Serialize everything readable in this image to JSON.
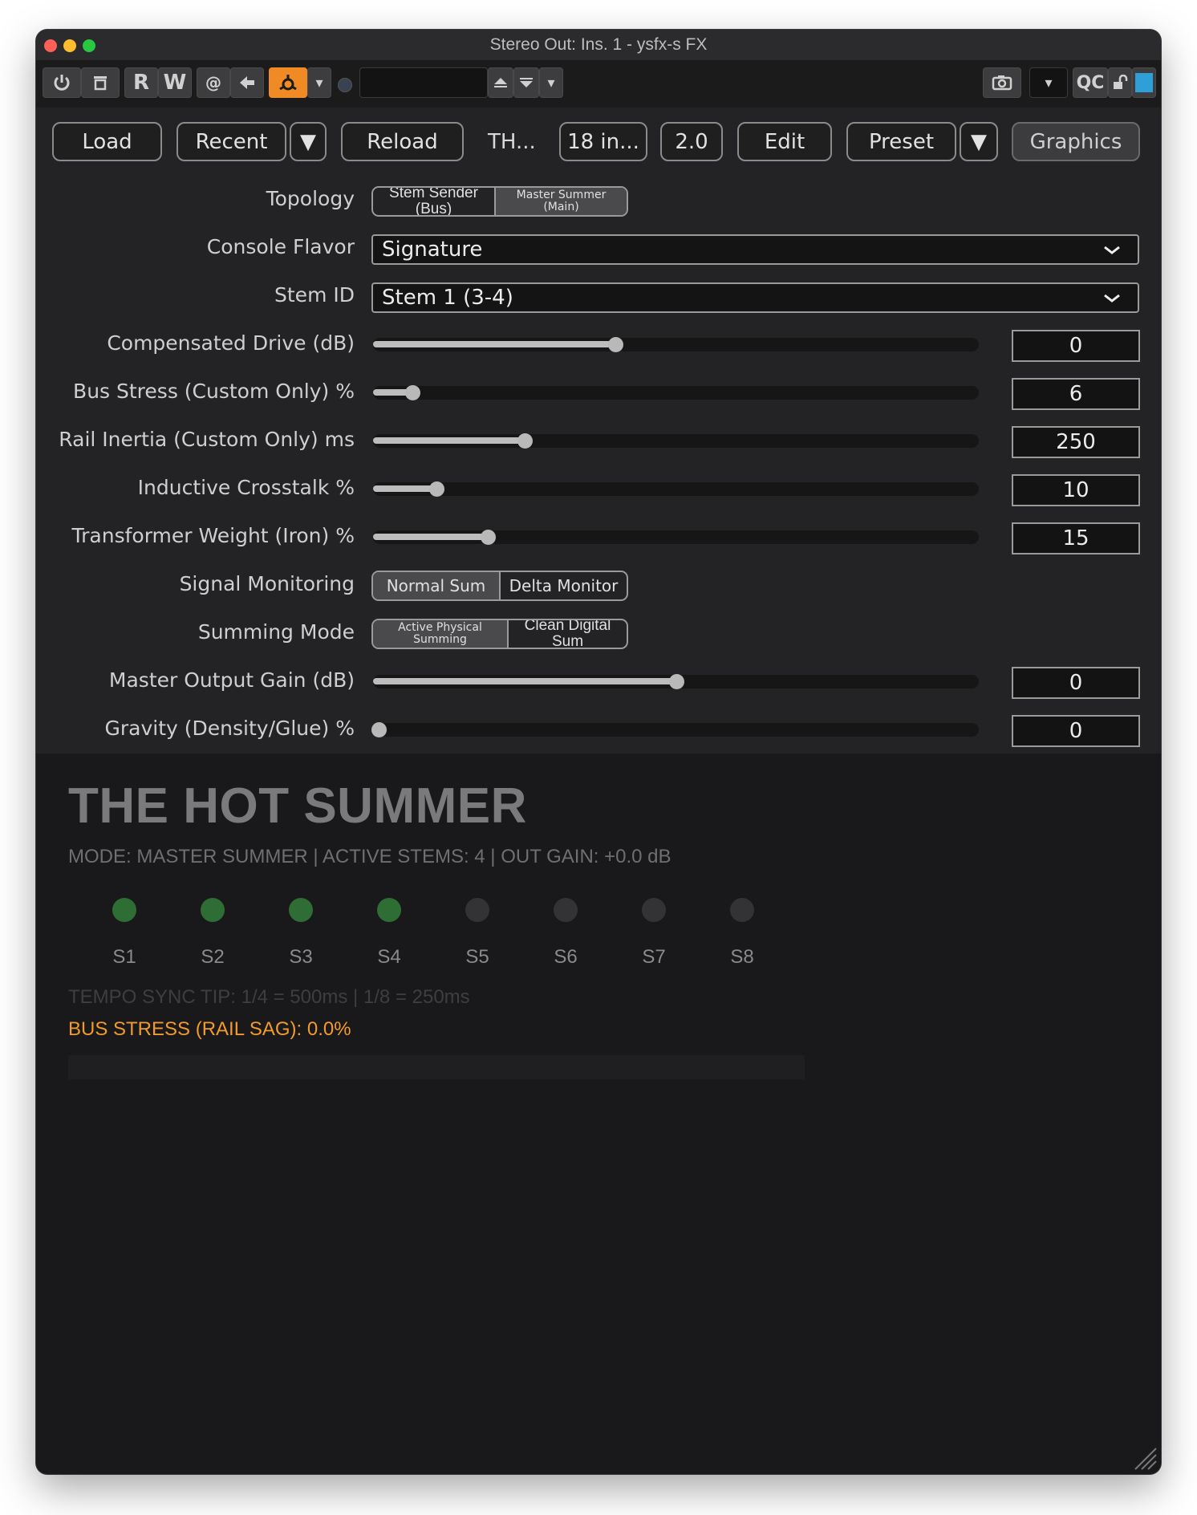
{
  "window": {
    "title": "Stereo Out: Ins. 1 - ysfx-s FX"
  },
  "colors": {
    "accent_orange": "#f08a24",
    "led_on": "#2e6d34",
    "led_off": "#333336",
    "stress_text": "#f29a2a",
    "qc_square": "#2f9fd8"
  },
  "toolbar": {
    "power_icon": "power-icon",
    "trash_icon": "trash-icon",
    "read_label": "R",
    "write_label": "W",
    "at_label": "@",
    "left_arrow_icon": "arrow-left-icon",
    "routing_icon": "routing-icon",
    "dropdown_glyph": "▾",
    "preset_field": "",
    "up_icon": "arrow-up-icon",
    "down_icon": "arrow-down-icon",
    "camera_icon": "camera-icon",
    "qc_label": "QC",
    "lock_icon": "lock-open-icon"
  },
  "header": {
    "load": "Load",
    "recent": "Recent",
    "recent_arrow": "▼",
    "reload": "Reload",
    "name_short": "TH...",
    "io": "18 in...",
    "version": "2.0",
    "edit": "Edit",
    "preset": "Preset",
    "preset_arrow": "▼",
    "graphics": "Graphics"
  },
  "params": {
    "topology": {
      "label": "Topology",
      "options": [
        "Stem Sender (Bus)",
        "Master Summer (Main)"
      ],
      "selected": 1
    },
    "console_flavor": {
      "label": "Console Flavor",
      "value": "Signature"
    },
    "stem_id": {
      "label": "Stem ID",
      "value": "Stem 1 (3-4)"
    },
    "compensated_drive": {
      "label": "Compensated Drive (dB)",
      "value": "0",
      "fraction": 0.4
    },
    "bus_stress": {
      "label": "Bus Stress (Custom Only) %",
      "value": "6",
      "fraction": 0.065
    },
    "rail_inertia": {
      "label": "Rail Inertia (Custom Only) ms",
      "value": "250",
      "fraction": 0.25
    },
    "inductive_crosstalk": {
      "label": "Inductive Crosstalk %",
      "value": "10",
      "fraction": 0.105
    },
    "transformer_weight": {
      "label": "Transformer Weight (Iron) %",
      "value": "15",
      "fraction": 0.19
    },
    "signal_monitoring": {
      "label": "Signal Monitoring",
      "options": [
        "Normal Sum",
        "Delta Monitor"
      ],
      "selected": 0
    },
    "summing_mode": {
      "label": "Summing Mode",
      "options": [
        "Active Physical Summing",
        "Clean Digital Sum"
      ],
      "selected": 0
    },
    "master_output_gain": {
      "label": "Master Output Gain (dB)",
      "value": "0",
      "fraction": 0.5
    },
    "gravity": {
      "label": "Gravity (Density/Glue) %",
      "value": "0",
      "fraction": 0.0
    }
  },
  "graphics": {
    "title": "THE HOT SUMMER",
    "mode_line": "MODE: MASTER SUMMER | ACTIVE STEMS: 4 | OUT GAIN: +0.0 dB",
    "stems": [
      {
        "label": "S1",
        "active": true
      },
      {
        "label": "S2",
        "active": true
      },
      {
        "label": "S3",
        "active": true
      },
      {
        "label": "S4",
        "active": true
      },
      {
        "label": "S5",
        "active": false
      },
      {
        "label": "S6",
        "active": false
      },
      {
        "label": "S7",
        "active": false
      },
      {
        "label": "S8",
        "active": false
      }
    ],
    "tempo_tip": "TEMPO SYNC TIP: 1/4 = 500ms | 1/8 = 250ms",
    "bus_stress_text": "BUS STRESS (RAIL SAG): 0.0%",
    "bus_stress_fraction": 0.0
  }
}
